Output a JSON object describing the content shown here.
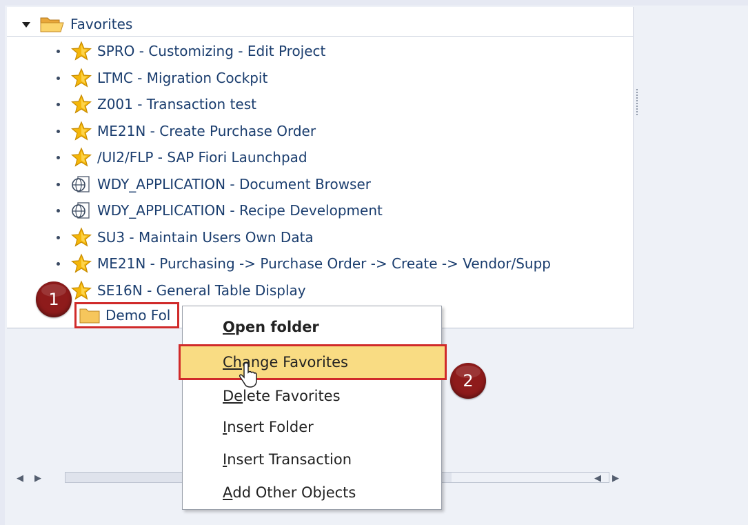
{
  "tree": {
    "root": {
      "label": "Favorites"
    },
    "items": [
      {
        "label": "SPRO - Customizing - Edit Project",
        "icon": "star-icon"
      },
      {
        "label": "LTMC - Migration Cockpit",
        "icon": "star-icon"
      },
      {
        "label": "Z001 - Transaction test",
        "icon": "star-icon"
      },
      {
        "label": "ME21N - Create Purchase Order",
        "icon": "star-icon"
      },
      {
        "label": "/UI2/FLP - SAP Fiori Launchpad",
        "icon": "star-icon"
      },
      {
        "label": "WDY_APPLICATION - Document Browser",
        "icon": "web-application-icon"
      },
      {
        "label": "WDY_APPLICATION - Recipe Development",
        "icon": "web-application-icon"
      },
      {
        "label": "SU3 - Maintain Users Own Data",
        "icon": "star-icon"
      },
      {
        "label": "ME21N - Purchasing -> Purchase Order -> Create -> Vendor/Supp",
        "icon": "star-icon"
      },
      {
        "label": "SE16N - General Table Display",
        "icon": "star-icon"
      }
    ],
    "selected_folder": {
      "label": "Demo Fol"
    }
  },
  "context_menu": {
    "items": [
      {
        "key": "O",
        "rest": "pen folder"
      },
      {
        "key": "Ch",
        "rest": "ange Favorites"
      },
      {
        "key": "De",
        "rest": "lete Favorites"
      },
      {
        "key": "I",
        "rest": "nsert Folder"
      },
      {
        "key": "I",
        "rest": "nsert Transaction"
      },
      {
        "key": "A",
        "rest": "dd Other Objects"
      }
    ]
  },
  "annotations": {
    "step1": "1",
    "step2": "2"
  },
  "colors": {
    "highlight": "#f9dc83",
    "callout_border": "#d02a2a",
    "badge": "#8e1b1b",
    "star": "#f5b70a",
    "text": "#1a3d6e"
  }
}
